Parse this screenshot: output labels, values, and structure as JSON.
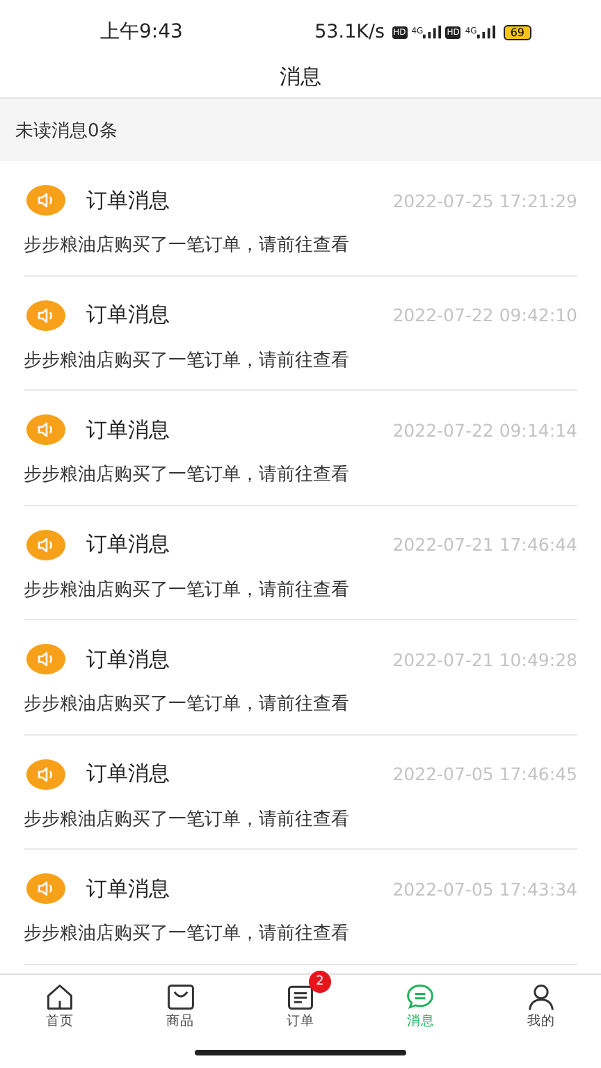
{
  "status_bar": {
    "time": "上午9:43",
    "speed": "53.1K/s",
    "sims": [
      {
        "hd": "HD",
        "network": "4G"
      },
      {
        "hd": "HD",
        "network": "4G"
      }
    ],
    "battery": "69"
  },
  "title": "消息",
  "unread": "未读消息0条",
  "messages": [
    {
      "title": "订单消息",
      "time": "2022-07-25 17:21:29",
      "body": "步步粮油店购买了一笔订单，请前往查看"
    },
    {
      "title": "订单消息",
      "time": "2022-07-22 09:42:10",
      "body": "步步粮油店购买了一笔订单，请前往查看"
    },
    {
      "title": "订单消息",
      "time": "2022-07-22 09:14:14",
      "body": "步步粮油店购买了一笔订单，请前往查看"
    },
    {
      "title": "订单消息",
      "time": "2022-07-21 17:46:44",
      "body": "步步粮油店购买了一笔订单，请前往查看"
    },
    {
      "title": "订单消息",
      "time": "2022-07-21 10:49:28",
      "body": "步步粮油店购买了一笔订单，请前往查看"
    },
    {
      "title": "订单消息",
      "time": "2022-07-05 17:46:45",
      "body": "步步粮油店购买了一笔订单，请前往查看"
    },
    {
      "title": "订单消息",
      "time": "2022-07-05 17:43:34",
      "body": "步步粮油店购买了一笔订单，请前往查看"
    }
  ],
  "tabs": [
    {
      "kind": "home",
      "label": "首页",
      "selected": false
    },
    {
      "kind": "goods",
      "label": "商品",
      "selected": false
    },
    {
      "kind": "orders",
      "label": "订单",
      "selected": false,
      "badge": "2"
    },
    {
      "kind": "messages",
      "label": "消息",
      "selected": true
    },
    {
      "kind": "profile",
      "label": "我的",
      "selected": false
    }
  ]
}
